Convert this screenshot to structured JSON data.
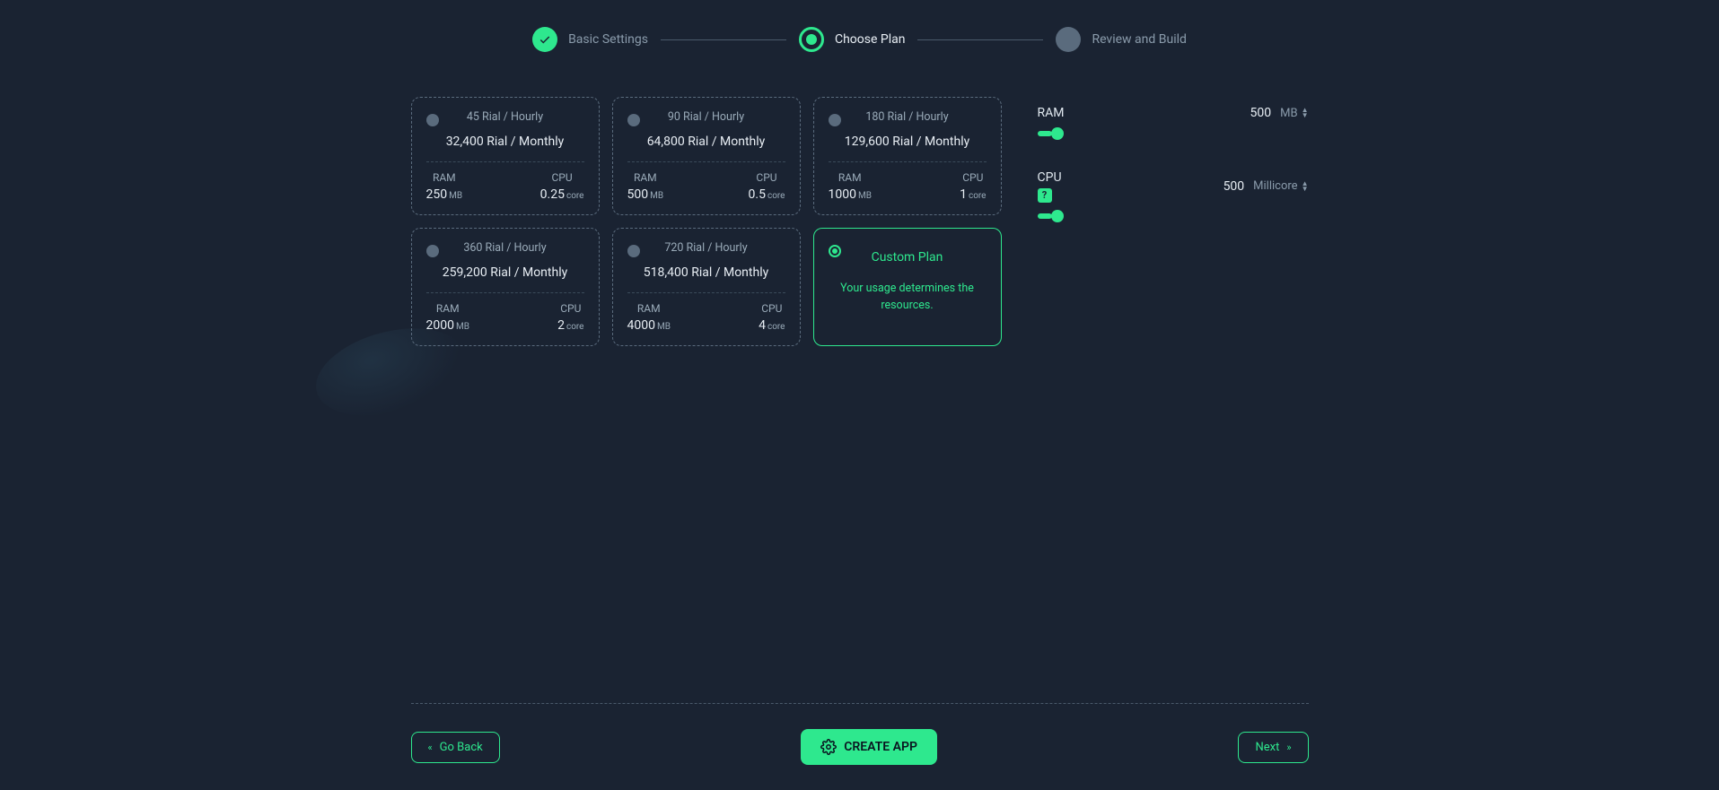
{
  "stepper": {
    "steps": [
      {
        "label": "Basic Settings",
        "state": "done"
      },
      {
        "label": "Choose Plan",
        "state": "active"
      },
      {
        "label": "Review and Build",
        "state": "pending"
      }
    ]
  },
  "plans": [
    {
      "hourly": "45 Rial / Hourly",
      "monthly": "32,400 Rial / Monthly",
      "ram": "250",
      "ram_unit": "MB",
      "cpu": "0.25",
      "cpu_unit": "core"
    },
    {
      "hourly": "90 Rial / Hourly",
      "monthly": "64,800 Rial / Monthly",
      "ram": "500",
      "ram_unit": "MB",
      "cpu": "0.5",
      "cpu_unit": "core"
    },
    {
      "hourly": "180 Rial / Hourly",
      "monthly": "129,600 Rial / Monthly",
      "ram": "1000",
      "ram_unit": "MB",
      "cpu": "1",
      "cpu_unit": "core"
    },
    {
      "hourly": "360 Rial / Hourly",
      "monthly": "259,200 Rial / Monthly",
      "ram": "2000",
      "ram_unit": "MB",
      "cpu": "2",
      "cpu_unit": "core"
    },
    {
      "hourly": "720 Rial / Hourly",
      "monthly": "518,400 Rial / Monthly",
      "ram": "4000",
      "ram_unit": "MB",
      "cpu": "4",
      "cpu_unit": "core"
    }
  ],
  "spec_labels": {
    "ram": "RAM",
    "cpu": "CPU"
  },
  "custom_plan": {
    "title": "Custom Plan",
    "desc": "Your usage determines the resources.",
    "selected": true
  },
  "sliders": {
    "ram": {
      "label": "RAM",
      "value": "500",
      "unit": "MB"
    },
    "cpu": {
      "label": "CPU",
      "value": "500",
      "unit": "Millicore",
      "help": "?"
    }
  },
  "buttons": {
    "back": "Go Back",
    "create": "CREATE APP",
    "next": "Next"
  }
}
